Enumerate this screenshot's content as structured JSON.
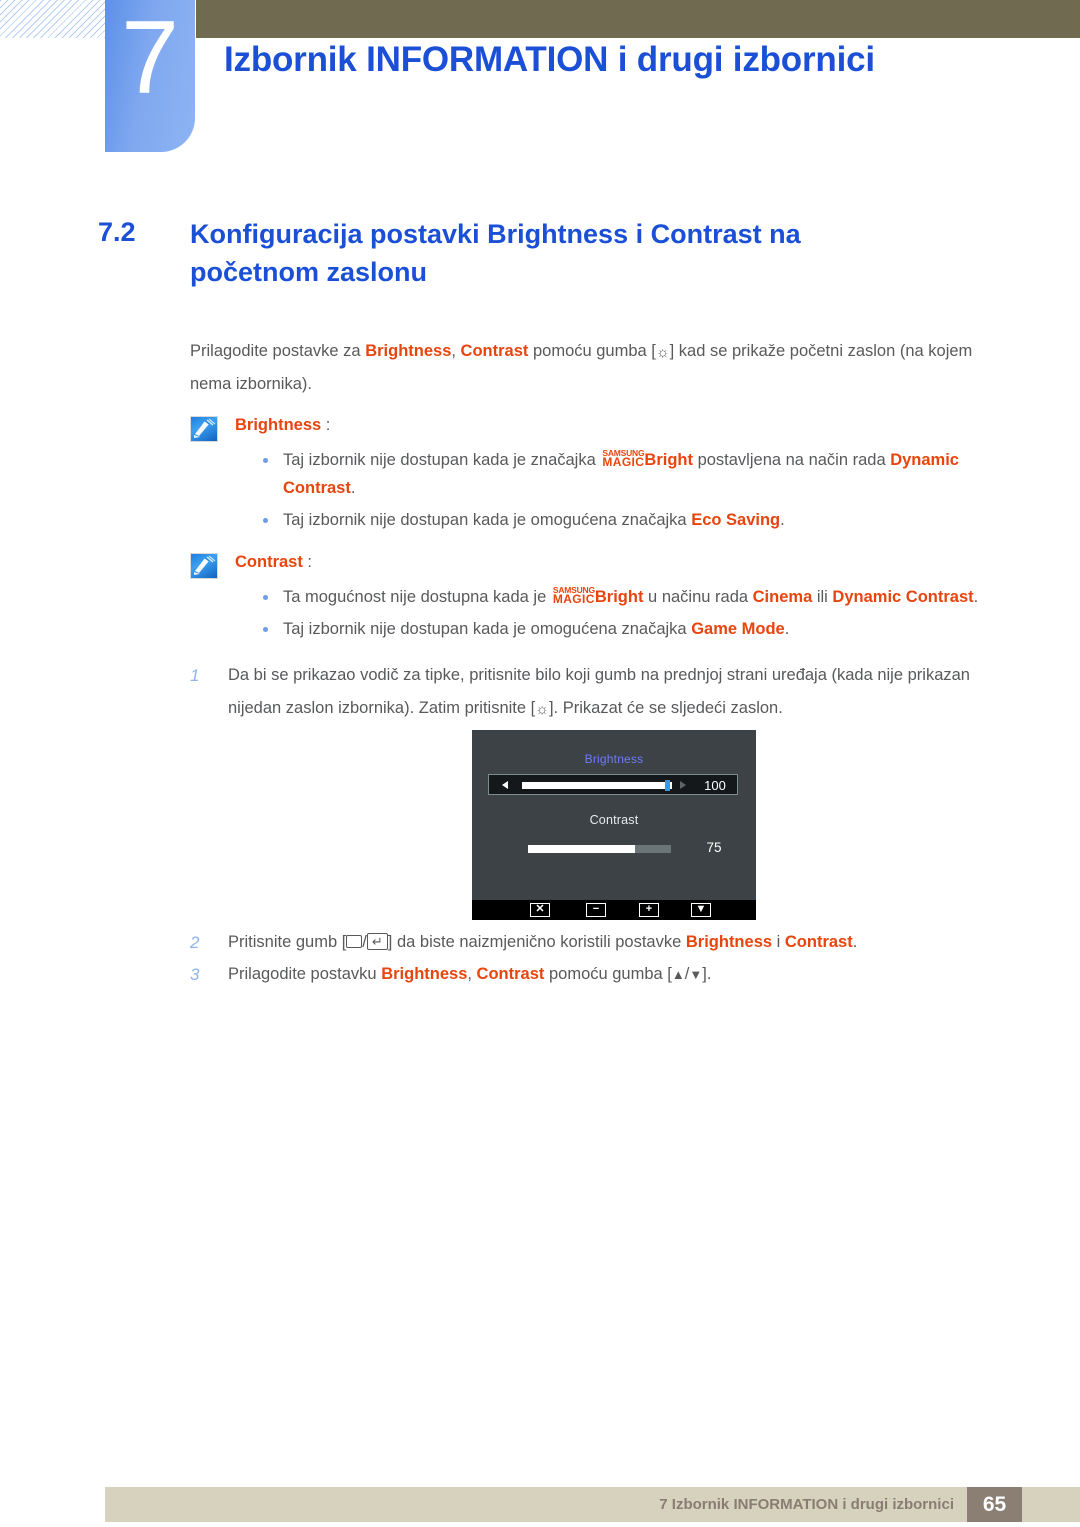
{
  "header": {
    "chapter_number": "7",
    "chapter_title": "Izbornik INFORMATION i drugi izbornici"
  },
  "section": {
    "number": "7.2",
    "title": "Konfiguracija postavki Brightness i Contrast na početnom zaslonu"
  },
  "intro": {
    "part1": "Prilagodite postavke za ",
    "term1": "Brightness",
    "sep1": ", ",
    "term2": "Contrast",
    "part2": " pomoću gumba [",
    "sun_icon": "☼",
    "part3": "] kad se prikaže početni zaslon (na kojem nema izbornika)."
  },
  "notes": [
    {
      "icon": "note-pen-icon",
      "title": "Brightness",
      "colon": " :",
      "bullets": [
        {
          "pre": "Taj izbornik nije dostupan kada je značajka ",
          "logo_top": "SAMSUNG",
          "logo_bottom": "MAGIC",
          "logo_word": "Bright",
          "mid": " postavljena na način rada ",
          "term": "Dynamic Contrast",
          "post": "."
        },
        {
          "pre": "Taj izbornik nije dostupan kada je omogućena značajka ",
          "term": "Eco Saving",
          "post": "."
        }
      ]
    },
    {
      "icon": "note-pen-icon",
      "title": "Contrast",
      "colon": " :",
      "bullets": [
        {
          "pre": "Ta mogućnost nije dostupna kada je ",
          "logo_top": "SAMSUNG",
          "logo_bottom": "MAGIC",
          "logo_word": "Bright",
          "mid": " u načinu rada ",
          "term": "Cinema",
          "mid2": " ili ",
          "term2": "Dynamic Contrast",
          "post": "."
        },
        {
          "pre": "Taj izbornik nije dostupan kada je omogućena značajka ",
          "term": "Game Mode",
          "post": "."
        }
      ]
    }
  ],
  "steps": [
    {
      "num": "1",
      "text_a": "Da bi se prikazao vodič za tipke, pritisnite bilo koji gumb na prednjoj strani uređaja (kada nije prikazan nijedan zaslon izbornika). Zatim pritisnite [",
      "sun_icon": "☼",
      "text_b": "]. Prikazat će se sljedeći zaslon."
    },
    {
      "num": "2",
      "text_a": "Pritisnite gumb [",
      "glyph_a": "rect-key-icon",
      "slash": "/",
      "glyph_b": "↵",
      "text_b": "] da biste naizmjenično koristili postavke ",
      "term1": "Brightness",
      "mid": " i ",
      "term2": "Contrast",
      "text_c": "."
    },
    {
      "num": "3",
      "text_a": "Prilagodite postavku ",
      "term1": "Brightness",
      "sep": ", ",
      "term2": "Contrast",
      "text_b": " pomoću gumba [",
      "up_arrow": "▲",
      "slash": "/",
      "down_arrow": "▼",
      "text_c": "]."
    }
  ],
  "osd": {
    "brightness_label": "Brightness",
    "brightness_value": "100",
    "brightness_fill_percent": 100,
    "contrast_label": "Contrast",
    "contrast_value": "75",
    "contrast_fill_percent": 75,
    "left_arrow": "◀",
    "right_arrow": "▶",
    "buttons": [
      {
        "name": "close-button",
        "glyph": "✕"
      },
      {
        "name": "minus-button",
        "glyph": "−"
      },
      {
        "name": "plus-button",
        "glyph": "+"
      },
      {
        "name": "down-button",
        "glyph": "▼"
      }
    ]
  },
  "footer": {
    "text": "7 Izbornik INFORMATION i drugi izbornici",
    "page": "65"
  },
  "colors": {
    "heading_blue": "#1a4fd6",
    "accent_orange": "#e8450e",
    "body_gray": "#58595b",
    "olive": "#706b50",
    "footer_beige": "#d7d2bd",
    "footer_brown": "#8b7f73",
    "tab_blue": "#7fa8ef"
  }
}
